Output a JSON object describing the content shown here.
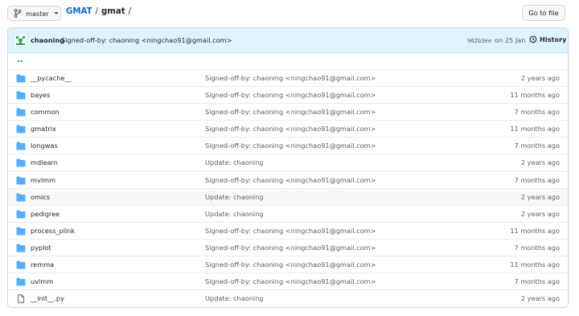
{
  "branch": {
    "name": "master",
    "icon": "git-branch-icon"
  },
  "breadcrumb": {
    "repo": "GMAT",
    "separator": "/",
    "current": "gmat",
    "trailing": "/"
  },
  "goto_file_label": "Go to file",
  "commit": {
    "author": "chaoning",
    "message": "Signed-off-by: chaoning <ningchao91@gmail.com>",
    "sha": "962b3ee",
    "date": "on 25 Jan",
    "history_label": "History"
  },
  "parent_link": "..",
  "colors": {
    "link": "#0969da",
    "folder": "#54aeff",
    "commit_bg": "#ddf4ff",
    "avatar": "#2da44e"
  },
  "files": [
    {
      "name": "__pycache__",
      "type": "folder",
      "message": "Signed-off-by: chaoning <ningchao91@gmail.com>",
      "age": "2 years ago"
    },
    {
      "name": "bayes",
      "type": "folder",
      "message": "Signed-off-by: chaoning <ningchao91@gmail.com>",
      "age": "11 months ago"
    },
    {
      "name": "common",
      "type": "folder",
      "message": "Signed-off-by: chaoning <ningchao91@gmail.com>",
      "age": "7 months ago"
    },
    {
      "name": "gmatrix",
      "type": "folder",
      "message": "Signed-off-by: chaoning <ningchao91@gmail.com>",
      "age": "11 months ago"
    },
    {
      "name": "longwas",
      "type": "folder",
      "message": "Signed-off-by: chaoning <ningchao91@gmail.com>",
      "age": "7 months ago"
    },
    {
      "name": "mdlearn",
      "type": "folder",
      "message": "Update: chaoning",
      "age": "2 years ago"
    },
    {
      "name": "mvlmm",
      "type": "folder",
      "message": "Signed-off-by: chaoning <ningchao91@gmail.com>",
      "age": "7 months ago"
    },
    {
      "name": "omics",
      "type": "folder",
      "message": "Update: chaoning",
      "age": "2 years ago"
    },
    {
      "name": "pedigree",
      "type": "folder",
      "message": "Update: chaoning",
      "age": "2 years ago"
    },
    {
      "name": "process_plink",
      "type": "folder",
      "message": "Signed-off-by: chaoning <ningchao91@gmail.com>",
      "age": "11 months ago"
    },
    {
      "name": "pyplot",
      "type": "folder",
      "message": "Signed-off-by: chaoning <ningchao91@gmail.com>",
      "age": "7 months ago"
    },
    {
      "name": "remma",
      "type": "folder",
      "message": "Signed-off-by: chaoning <ningchao91@gmail.com>",
      "age": "11 months ago"
    },
    {
      "name": "uvlmm",
      "type": "folder",
      "message": "Signed-off-by: chaoning <ningchao91@gmail.com>",
      "age": "7 months ago"
    },
    {
      "name": "__init__.py",
      "type": "file",
      "message": "Update: chaoning",
      "age": "2 years ago"
    }
  ]
}
